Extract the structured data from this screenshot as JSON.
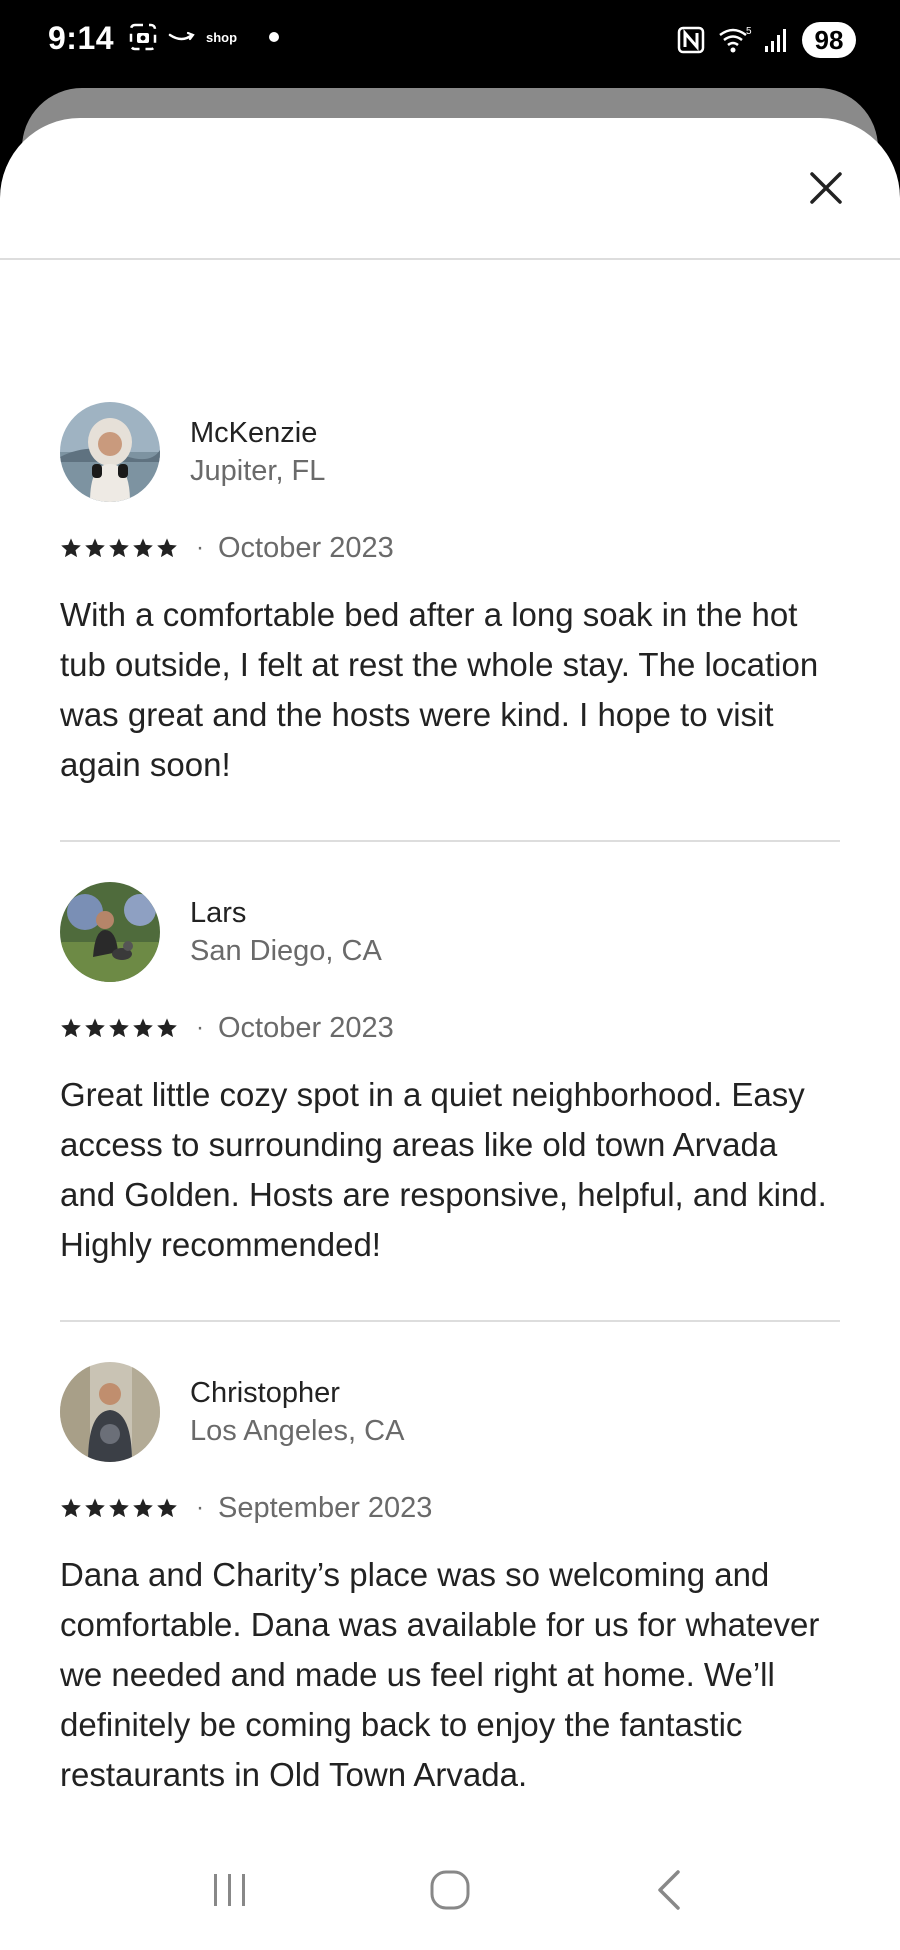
{
  "status_bar": {
    "time": "9:14",
    "shop_label": "shop",
    "battery": "98"
  },
  "reviews": [
    {
      "name": "McKenzie",
      "location": "Jupiter, FL",
      "rating": 5,
      "date": "October 2023",
      "text": "With a comfortable bed after a long soak in the hot tub outside, I felt at rest the whole stay. The location was great and the hosts were kind. I hope to visit again soon!"
    },
    {
      "name": "Lars",
      "location": "San Diego, CA",
      "rating": 5,
      "date": "October 2023",
      "text": "Great little cozy spot in a quiet neighborhood. Easy access to surrounding areas like old town Arvada and Golden. Hosts are responsive, helpful, and kind. Highly recommended!"
    },
    {
      "name": "Christopher",
      "location": "Los Angeles, CA",
      "rating": 5,
      "date": "September 2023",
      "text": "Dana and Charity’s place was so welcoming and comfortable. Dana was available for us for whatever we needed and made us feel right at home. We’ll definitely be coming back to enjoy the fantastic restaurants in Old Town Arvada.\n\nDana was so sweet and accommodating for our"
    }
  ],
  "separator": "·"
}
